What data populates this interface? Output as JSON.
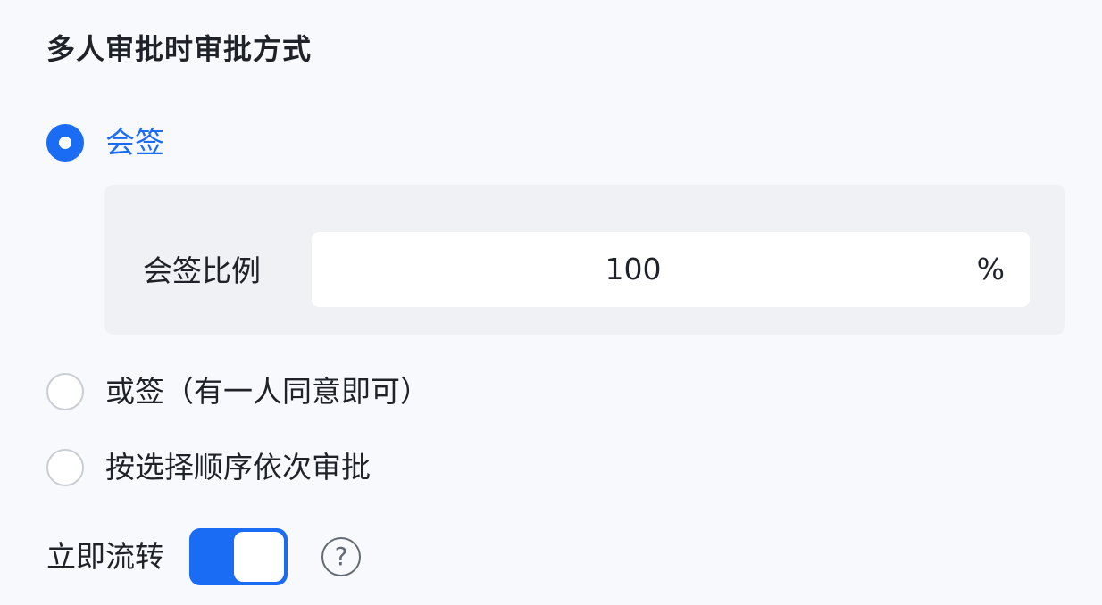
{
  "section": {
    "title": "多人审批时审批方式"
  },
  "options": [
    {
      "label": "会签",
      "checked": true
    },
    {
      "label": "或签（有一人同意即可）",
      "checked": false
    },
    {
      "label": "按选择顺序依次审批",
      "checked": false
    }
  ],
  "ratio": {
    "label": "会签比例",
    "value": "100",
    "unit": "%"
  },
  "flow": {
    "label": "立即流转",
    "toggle_on": true,
    "help_icon": "question-circle-icon",
    "help_glyph": "?"
  },
  "colors": {
    "accent": "#1a6cf5",
    "text": "#1f2329",
    "panel": "#eff1f4"
  }
}
